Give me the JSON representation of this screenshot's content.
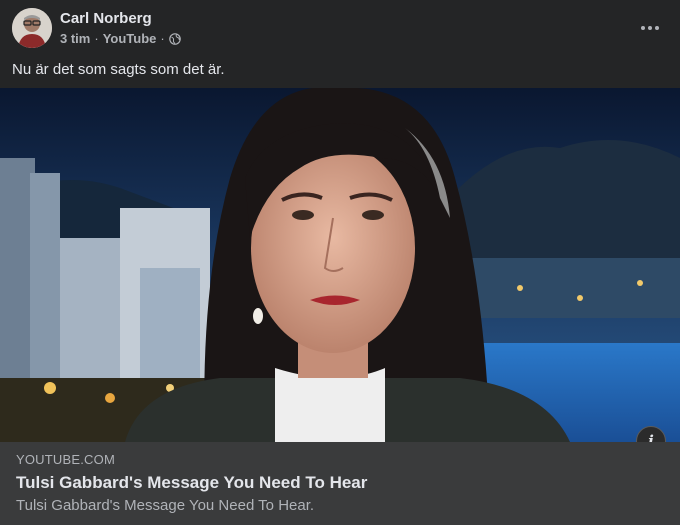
{
  "post": {
    "author": "Carl Norberg",
    "time": "3 tim",
    "separator": "·",
    "source": "YouTube",
    "separator2": "·",
    "audience_icon": "globe-icon",
    "text": "Nu är det som sagts som det är.",
    "more_icon": "more-options-icon"
  },
  "link_card": {
    "domain": "YOUTUBE.COM",
    "title": "Tulsi Gabbard's Message You Need To Hear",
    "description": "Tulsi Gabbard's Message You Need To Hear.",
    "info_label": "i"
  },
  "colors": {
    "background": "#242526",
    "card": "#3a3b3c",
    "primary_text": "#e4e6eb",
    "secondary_text": "#b0b3b8"
  }
}
